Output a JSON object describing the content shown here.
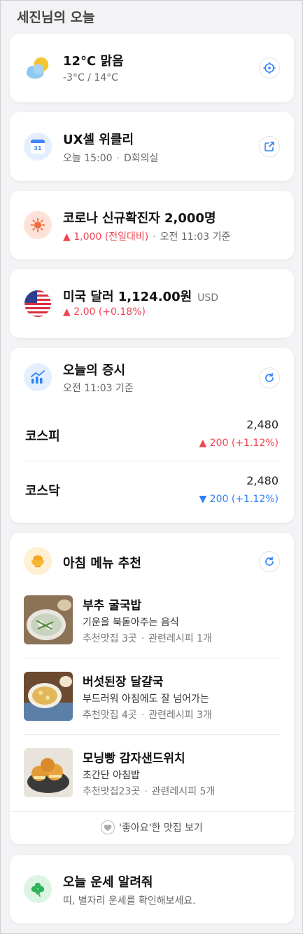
{
  "page": {
    "title": "세진님의 오늘"
  },
  "weather": {
    "title": "12°C 맑음",
    "range": "-3°C / 14°C",
    "icon": "partly-sunny-icon",
    "action_icon": "locate-icon"
  },
  "calendar": {
    "title": "UX셀 위클리",
    "time": "오늘 15:00",
    "place": "D회의실",
    "icon": "calendar-icon",
    "icon_text": "31",
    "action_icon": "external-link-icon"
  },
  "covid": {
    "title": "코로나 신규확진자 2,000명",
    "change": "▲ 1,000 (전일대비)",
    "time": "오전 11:03 기준",
    "icon": "virus-icon"
  },
  "currency": {
    "title": "미국 달러 1,124.00원",
    "unit": "USD",
    "change": "▲ 2.00 (+0.18%)",
    "icon": "us-flag-icon"
  },
  "stocks": {
    "title": "오늘의 증시",
    "time": "오전 11:03 기준",
    "icon": "trend-chart-icon",
    "action_icon": "refresh-icon",
    "items": [
      {
        "name": "코스피",
        "value": "2,480",
        "change": "▲ 200 (+1.12%)",
        "direction": "up"
      },
      {
        "name": "코스닥",
        "value": "2,480",
        "change": "▼ 200 (+1.12%)",
        "direction": "down"
      }
    ]
  },
  "breakfast": {
    "title": "아침 메뉴 추천",
    "icon": "rice-bowl-icon",
    "action_icon": "refresh-icon",
    "items": [
      {
        "name": "부추 굴국밥",
        "desc": "기운을 북돋아주는 음식",
        "places": "추천맛집 3곳",
        "recipes": "관련레시피 1개"
      },
      {
        "name": "버섯된장 달걀국",
        "desc": "부드러워 아침에도 잘 넘어가는",
        "places": "추천맛집 4곳",
        "recipes": "관련레시피 3개"
      },
      {
        "name": "모닝빵 감자샌드위치",
        "desc": "초간단 아침밥",
        "places": "추천맛집23곳",
        "recipes": "관련레시피 5개"
      }
    ],
    "like_link": "'좋아요'한 맛집 보기"
  },
  "fortune": {
    "title": "오늘 운세 알려줘",
    "desc": "띠, 별자리 운세를 확인해보세요.",
    "icon": "clover-icon"
  },
  "colors": {
    "up": "#f04452",
    "down": "#3182f6",
    "background": "#f3f3f5"
  }
}
